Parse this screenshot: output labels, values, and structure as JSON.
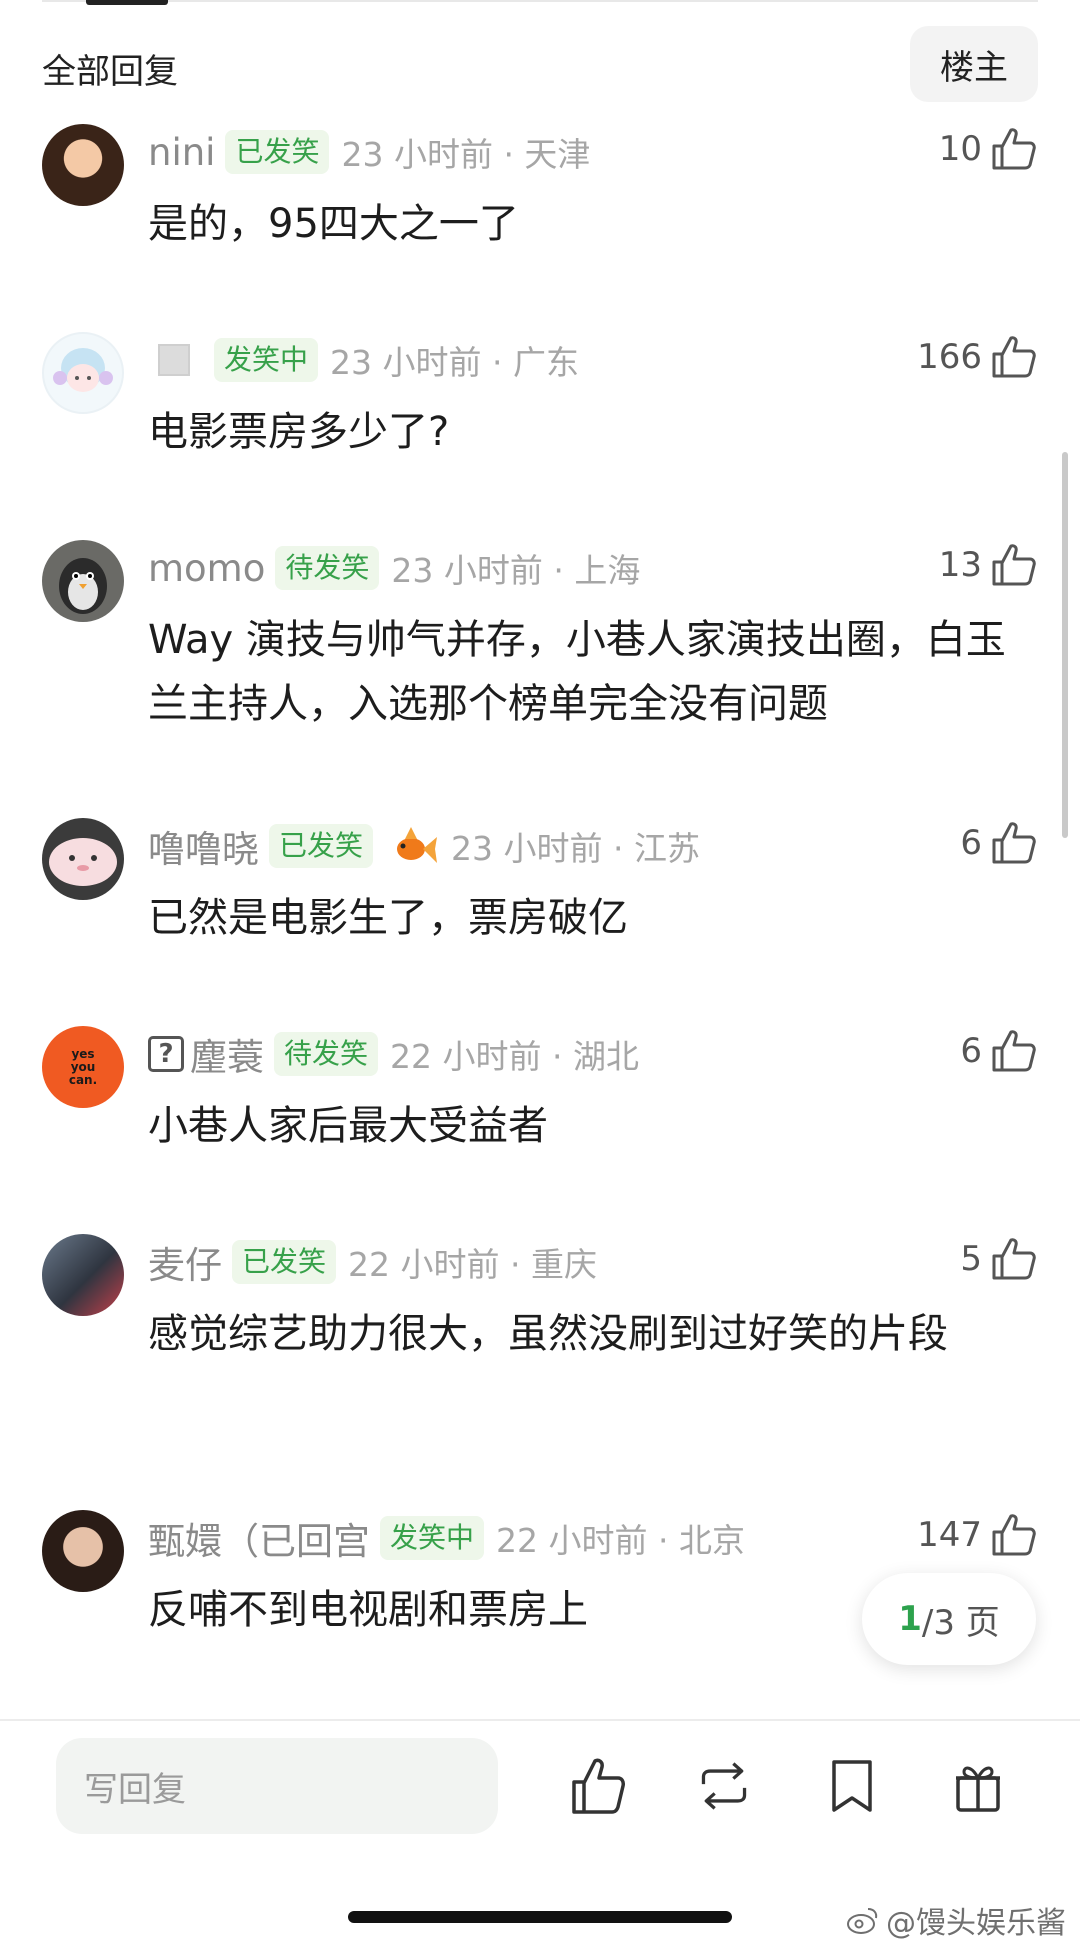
{
  "header": {
    "title": "全部回复",
    "op_label": "楼主"
  },
  "comments": [
    {
      "username": "nini",
      "badge": "已发笑",
      "time_loc": "23 小时前 · 天津",
      "likes": "10",
      "text": "是的，95四大之一了"
    },
    {
      "username": "",
      "badge": "发笑中",
      "time_loc": "23 小时前 · 广东",
      "likes": "166",
      "text": "电影票房多少了?"
    },
    {
      "username": "momo",
      "badge": "待发笑",
      "time_loc": "23 小时前 · 上海",
      "likes": "13",
      "text": "Way 演技与帅气并存，小巷人家演技出圈，白玉兰主持人，入选那个榜单完全没有问题"
    },
    {
      "username": "噜噜晓",
      "badge": "已发笑",
      "time_loc": "23 小时前 · 江苏",
      "likes": "6",
      "text": "已然是电影生了，票房破亿"
    },
    {
      "username": "麈蓑",
      "badge": "待发笑",
      "time_loc": "22 小时前 · 湖北",
      "likes": "6",
      "text": "小巷人家后最大受益者",
      "avatar_text": "yes you can."
    },
    {
      "username": "麦仔",
      "badge": "已发笑",
      "time_loc": "22 小时前 · 重庆",
      "likes": "5",
      "text": "感觉综艺助力很大，虽然没刷到过好笑的片段"
    },
    {
      "username": "甄嬛（已回宫",
      "badge": "发笑中",
      "time_loc": "22 小时前 · 北京",
      "likes": "147",
      "text": "反哺不到电视剧和票房上"
    }
  ],
  "pagination": {
    "current": "1",
    "total": "/3 页"
  },
  "bottom_bar": {
    "reply_placeholder": "写回复",
    "icons": [
      "thumbs-up-icon",
      "repost-icon",
      "bookmark-icon",
      "gift-icon"
    ]
  },
  "watermark": "@馒头娱乐酱",
  "colors": {
    "badge_text": "#37a14a",
    "badge_bg": "#eef7ea",
    "page_current": "#2da24d",
    "meta_gray": "#a6a6a6"
  }
}
